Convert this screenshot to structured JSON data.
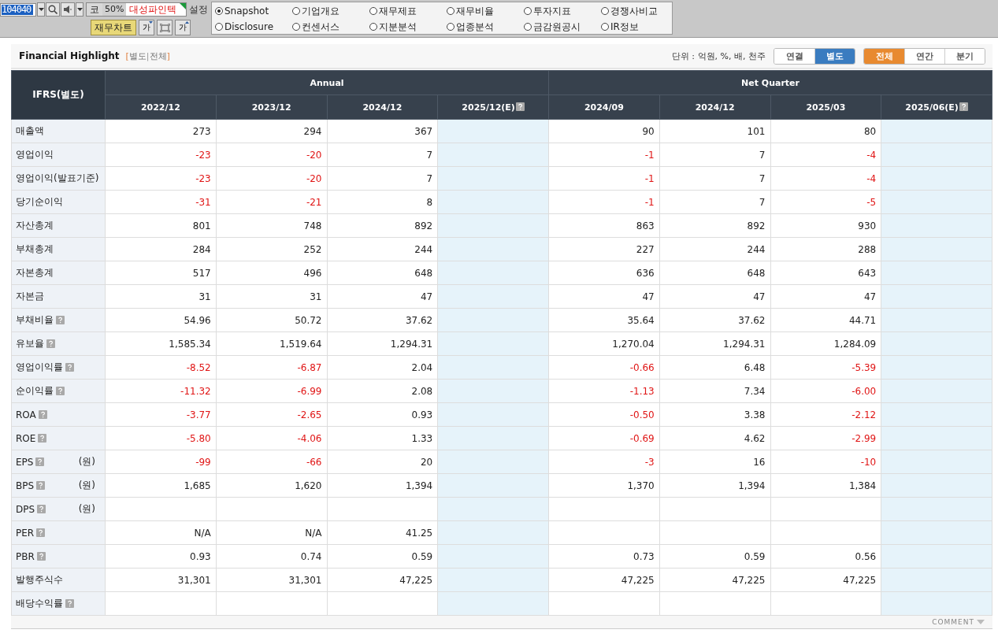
{
  "toolbar": {
    "code": "104040",
    "market": "코",
    "zoom": "50%",
    "company": "대성파인텍",
    "settings": "설정",
    "chart_button": "재무차트",
    "font_small": "가",
    "font_large": "가"
  },
  "menu": [
    {
      "label": "Snapshot",
      "selected": true
    },
    {
      "label": "기업개요",
      "selected": false
    },
    {
      "label": "재무제표",
      "selected": false
    },
    {
      "label": "재무비율",
      "selected": false
    },
    {
      "label": "투자지표",
      "selected": false
    },
    {
      "label": "경쟁사비교",
      "selected": false
    },
    {
      "label": "Disclosure",
      "selected": false
    },
    {
      "label": "컨센서스",
      "selected": false
    },
    {
      "label": "지분분석",
      "selected": false
    },
    {
      "label": "업종분석",
      "selected": false
    },
    {
      "label": "금감원공시",
      "selected": false
    },
    {
      "label": "IR정보",
      "selected": false
    }
  ],
  "section": {
    "title": "Financial Highlight",
    "bracket_open": "[",
    "sub_a": "별도",
    "sep": "|",
    "sub_b": "전체",
    "bracket_close": "]",
    "unit": "단위 : 억원, %, 배, 천주",
    "basis_tabs": [
      {
        "label": "연결",
        "selected": false
      },
      {
        "label": "별도",
        "selected": true
      }
    ],
    "period_tabs": [
      {
        "label": "전체",
        "selected": true
      },
      {
        "label": "연간",
        "selected": false
      },
      {
        "label": "분기",
        "selected": false
      }
    ]
  },
  "table": {
    "corner": "IFRS(별도)",
    "groups": [
      {
        "label": "Annual"
      },
      {
        "label": "Net Quarter"
      }
    ],
    "columns": [
      {
        "label": "2022/12",
        "estimate": false
      },
      {
        "label": "2023/12",
        "estimate": false
      },
      {
        "label": "2024/12",
        "estimate": false
      },
      {
        "label": "2025/12(E)",
        "estimate": true
      },
      {
        "label": "2024/09",
        "estimate": false
      },
      {
        "label": "2024/12",
        "estimate": false
      },
      {
        "label": "2025/03",
        "estimate": false
      },
      {
        "label": "2025/06(E)",
        "estimate": true
      }
    ],
    "rows": [
      {
        "label": "매출액",
        "help": false,
        "cells": [
          "273",
          "294",
          "367",
          null,
          "90",
          "101",
          "80",
          null
        ]
      },
      {
        "label": "영업이익",
        "help": false,
        "cells": [
          "-23",
          "-20",
          "7",
          null,
          "-1",
          "7",
          "-4",
          null
        ],
        "negative": [
          true,
          true,
          false,
          false,
          true,
          false,
          true,
          false
        ]
      },
      {
        "label": "영업이익(발표기준)",
        "help": false,
        "cells": [
          "-23",
          "-20",
          "7",
          null,
          "-1",
          "7",
          "-4",
          null
        ],
        "negative": [
          true,
          true,
          false,
          false,
          true,
          false,
          true,
          false
        ]
      },
      {
        "label": "당기순이익",
        "help": false,
        "cells": [
          "-31",
          "-21",
          "8",
          null,
          "-1",
          "7",
          "-5",
          null
        ],
        "negative": [
          true,
          true,
          false,
          false,
          true,
          false,
          true,
          false
        ]
      },
      {
        "label": "자산총계",
        "help": false,
        "cells": [
          "801",
          "748",
          "892",
          null,
          "863",
          "892",
          "930",
          null
        ]
      },
      {
        "label": "부채총계",
        "help": false,
        "cells": [
          "284",
          "252",
          "244",
          null,
          "227",
          "244",
          "288",
          null
        ]
      },
      {
        "label": "자본총계",
        "help": false,
        "cells": [
          "517",
          "496",
          "648",
          null,
          "636",
          "648",
          "643",
          null
        ]
      },
      {
        "label": "자본금",
        "help": false,
        "cells": [
          "31",
          "31",
          "47",
          null,
          "47",
          "47",
          "47",
          null
        ]
      },
      {
        "label": "부채비율",
        "help": true,
        "cells": [
          "54.96",
          "50.72",
          "37.62",
          null,
          "35.64",
          "37.62",
          "44.71",
          null
        ]
      },
      {
        "label": "유보율",
        "help": true,
        "cells": [
          "1,585.34",
          "1,519.64",
          "1,294.31",
          null,
          "1,270.04",
          "1,294.31",
          "1,284.09",
          null
        ]
      },
      {
        "label": "영업이익률",
        "help": true,
        "cells": [
          "-8.52",
          "-6.87",
          "2.04",
          null,
          "-0.66",
          "6.48",
          "-5.39",
          null
        ],
        "negative": [
          true,
          true,
          false,
          false,
          true,
          false,
          true,
          false
        ]
      },
      {
        "label": "순이익률",
        "help": true,
        "cells": [
          "-11.32",
          "-6.99",
          "2.08",
          null,
          "-1.13",
          "7.34",
          "-6.00",
          null
        ],
        "negative": [
          true,
          true,
          false,
          false,
          true,
          false,
          true,
          false
        ]
      },
      {
        "label": "ROA",
        "help": true,
        "cells": [
          "-3.77",
          "-2.65",
          "0.93",
          null,
          "-0.50",
          "3.38",
          "-2.12",
          null
        ],
        "negative": [
          true,
          true,
          false,
          false,
          true,
          false,
          true,
          false
        ]
      },
      {
        "label": "ROE",
        "help": true,
        "cells": [
          "-5.80",
          "-4.06",
          "1.33",
          null,
          "-0.69",
          "4.62",
          "-2.99",
          null
        ],
        "negative": [
          true,
          true,
          false,
          false,
          true,
          false,
          true,
          false
        ]
      },
      {
        "label": "EPS",
        "help": true,
        "unit": "(원)",
        "cells": [
          "-99",
          "-66",
          "20",
          null,
          "-3",
          "16",
          "-10",
          null
        ],
        "negative": [
          true,
          true,
          false,
          false,
          true,
          false,
          true,
          false
        ]
      },
      {
        "label": "BPS",
        "help": true,
        "unit": "(원)",
        "cells": [
          "1,685",
          "1,620",
          "1,394",
          null,
          "1,370",
          "1,394",
          "1,384",
          null
        ]
      },
      {
        "label": "DPS",
        "help": true,
        "unit": "(원)",
        "cells": [
          null,
          null,
          null,
          null,
          null,
          null,
          null,
          null
        ]
      },
      {
        "label": "PER",
        "help": true,
        "cells": [
          "N/A",
          "N/A",
          "41.25",
          null,
          null,
          null,
          null,
          null
        ]
      },
      {
        "label": "PBR",
        "help": true,
        "cells": [
          "0.93",
          "0.74",
          "0.59",
          null,
          "0.73",
          "0.59",
          "0.56",
          null
        ]
      },
      {
        "label": "발행주식수",
        "help": false,
        "cells": [
          "31,301",
          "31,301",
          "47,225",
          null,
          "47,225",
          "47,225",
          "47,225",
          null
        ]
      },
      {
        "label": "배당수익률",
        "help": true,
        "cells": [
          null,
          null,
          null,
          null,
          null,
          null,
          null,
          null
        ]
      }
    ]
  },
  "footer": {
    "comment": "COMMENT"
  }
}
